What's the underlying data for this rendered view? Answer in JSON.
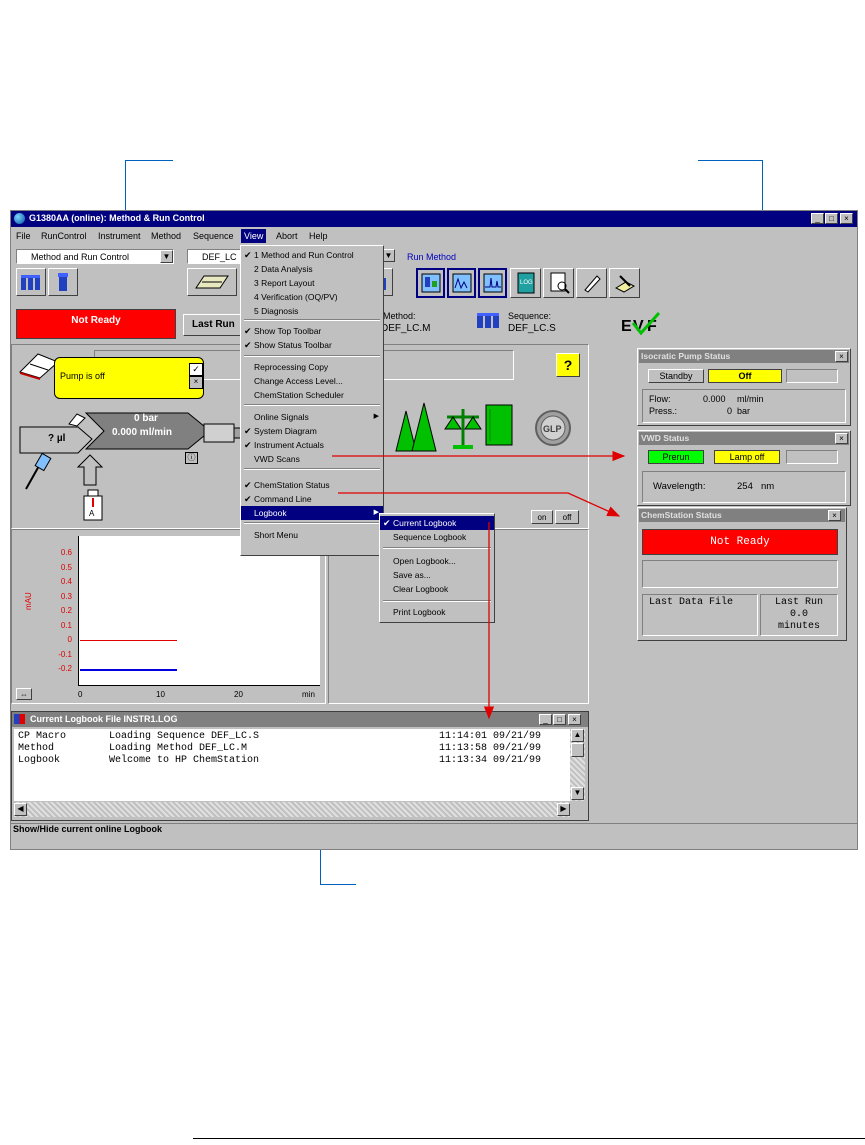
{
  "window": {
    "title": "G1380AA (online): Method & Run Control"
  },
  "menubar": [
    "File",
    "RunControl",
    "Instrument",
    "Method",
    "Sequence",
    "View",
    "Abort",
    "Help"
  ],
  "toolbar": {
    "view_select": "Method and Run Control",
    "method_select": "DEF_LC",
    "run_method_label": "Run Method"
  },
  "status_toolbar": {
    "not_ready": "Not Ready",
    "last_run": "Last Run",
    "method_label": "Method:",
    "method_value": "DEF_LC.M",
    "sequence_label": "Sequence:",
    "sequence_value": "DEF_LC.S"
  },
  "view_menu": {
    "items": [
      {
        "label": "1 Method and Run Control",
        "checked": true
      },
      {
        "label": "2 Data Analysis",
        "checked": false
      },
      {
        "label": "3 Report Layout",
        "checked": false
      },
      {
        "label": "4 Verification (OQ/PV)",
        "checked": false
      },
      {
        "label": "5 Diagnosis",
        "checked": false
      },
      {
        "label": "Show Top Toolbar",
        "checked": true
      },
      {
        "label": "Show Status Toolbar",
        "checked": true
      },
      {
        "label": "Reprocessing Copy",
        "checked": false
      },
      {
        "label": "Change Access Level...",
        "checked": false
      },
      {
        "label": "ChemStation Scheduler",
        "checked": false
      },
      {
        "label": "Online Signals",
        "checked": false,
        "submenu": true
      },
      {
        "label": "System Diagram",
        "checked": true
      },
      {
        "label": "Instrument Actuals",
        "checked": true
      },
      {
        "label": "VWD Scans",
        "checked": false
      },
      {
        "label": "ChemStation Status",
        "checked": true
      },
      {
        "label": "Command Line",
        "checked": true
      },
      {
        "label": "Logbook",
        "checked": false,
        "submenu": true,
        "highlighted": true
      },
      {
        "label": "Short Menu",
        "checked": false
      }
    ]
  },
  "logbook_menu": {
    "items": [
      {
        "label": "Current Logbook",
        "checked": true,
        "highlighted": true
      },
      {
        "label": "Sequence Logbook",
        "checked": false
      },
      {
        "label": "Open Logbook...",
        "checked": false
      },
      {
        "label": "Save as...",
        "checked": false
      },
      {
        "label": "Clear Logbook",
        "checked": false
      },
      {
        "label": "Print Logbook",
        "checked": false
      }
    ]
  },
  "diagram": {
    "tooltip": "Pump is off",
    "pressure": "0 bar",
    "flow": "0.000 ml/min",
    "injection": "? µl",
    "vial_label": "A",
    "on_btn": "on",
    "off_btn": "off",
    "help_glyph": "?",
    "glp": "GLP"
  },
  "plot": {
    "y_label": "mAU",
    "y_ticks": [
      "0.6",
      "0.5",
      "0.4",
      "0.3",
      "0.2",
      "0.1",
      "0",
      "-0.1",
      "-0.2"
    ],
    "x_ticks": [
      "0",
      "10",
      "20"
    ],
    "x_unit": "min"
  },
  "logbook_window": {
    "title": "Current Logbook File INSTR1.LOG",
    "rows": [
      {
        "source": "CP Macro",
        "message": "Loading Sequence DEF_LC.S",
        "time": "11:14:01 09/21/99"
      },
      {
        "source": "Method",
        "message": "Loading Method DEF_LC.M",
        "time": "11:13:58 09/21/99"
      },
      {
        "source": "Logbook",
        "message": "Welcome to HP ChemStation",
        "time": "11:13:34 09/21/99"
      }
    ]
  },
  "statusbar": "Show/Hide current online Logbook",
  "pump_status": {
    "title": "Isocratic Pump Status",
    "mode": "Standby",
    "state": "Off",
    "flow_label": "Flow:",
    "flow_value": "0.000",
    "flow_unit": "ml/min",
    "press_label": "Press.:",
    "press_value": "0",
    "press_unit": "bar"
  },
  "vwd_status": {
    "title": "VWD Status",
    "mode": "Prerun",
    "lamp": "Lamp off",
    "wavelength_label": "Wavelength:",
    "wavelength_value": "254",
    "wavelength_unit": "nm"
  },
  "chemstation_status": {
    "title": "ChemStation Status",
    "state": "Not Ready",
    "last_data_file": "Last Data File",
    "last_run_label": "Last Run",
    "last_run_value": "0.0",
    "last_run_unit": "minutes"
  },
  "colors": {
    "titlebar": "#000080",
    "panel_titlebar": "#808080",
    "not_ready": "#ff0000",
    "status_yellow": "#ffff00",
    "status_green": "#00ff00",
    "tooltip": "#ffff00",
    "callout_line": "#0060c0",
    "arrow": "#e00000"
  }
}
